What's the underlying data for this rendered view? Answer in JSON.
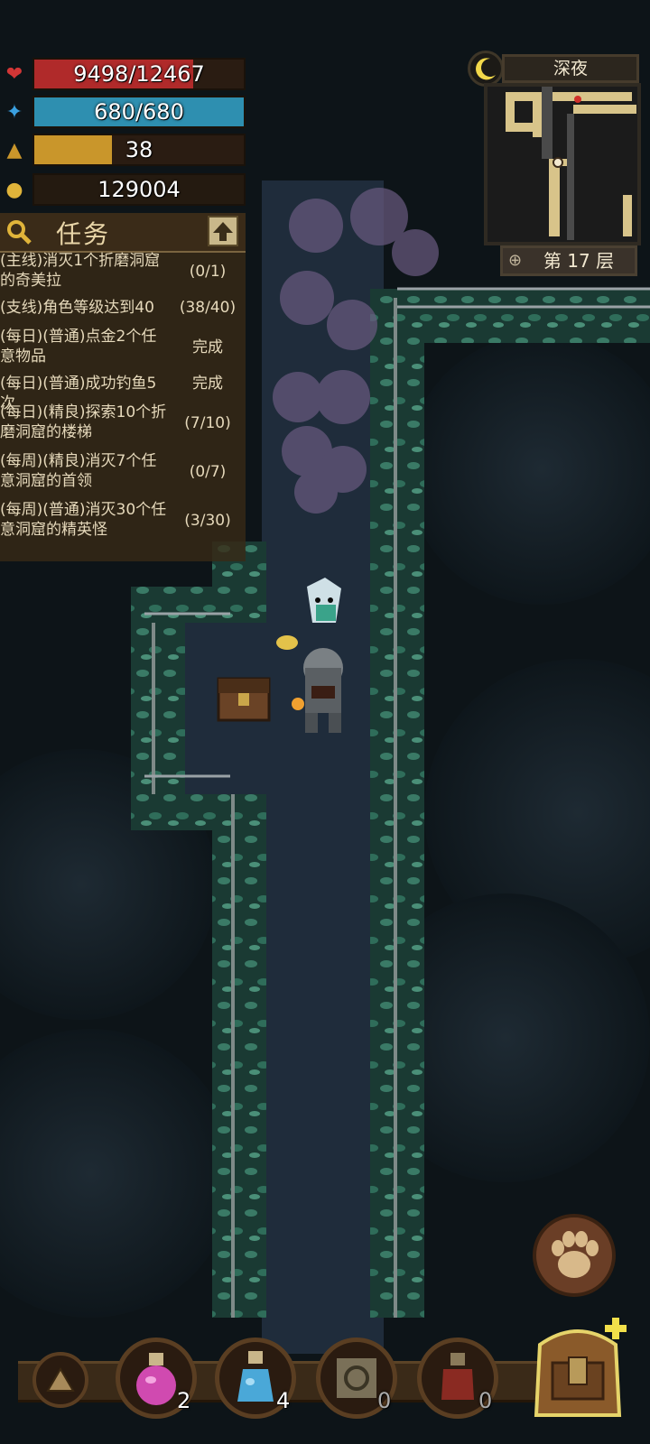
{
  "stats": {
    "hp": {
      "text": "9498/12467",
      "fraction": 0.76,
      "color": "#b02a2a"
    },
    "mp": {
      "text": "680/680",
      "fraction": 1.0,
      "color": "#2e8fb0"
    },
    "level": {
      "text": "38",
      "fraction": 0.37,
      "color": "#c9962b"
    },
    "gold": {
      "text": "129004"
    }
  },
  "quest_panel": {
    "title": "任务",
    "tasks": [
      {
        "name": "(主线)消灭1个折磨洞窟的奇美拉",
        "progress": "(0/1)"
      },
      {
        "name": "(支线)角色等级达到40",
        "progress": "(38/40)"
      },
      {
        "name": "(每日)(普通)点金2个任意物品",
        "progress": "完成"
      },
      {
        "name": "(每日)(普通)成功钓鱼5次",
        "progress": "完成"
      },
      {
        "name": "(每日)(精良)探索10个折磨洞窟的楼梯",
        "progress": "(7/10)"
      },
      {
        "name": "(每周)(精良)消灭7个任意洞窟的首领",
        "progress": "(0/7)"
      },
      {
        "name": "(每周)(普通)消灭30个任意洞窟的精英怪",
        "progress": "(3/30)"
      }
    ]
  },
  "minimap": {
    "time_of_day": "深夜",
    "floor": "第 17 层"
  },
  "hotbar": {
    "items": [
      {
        "icon": "pink-potion-icon",
        "count": "2"
      },
      {
        "icon": "blue-potion-icon",
        "count": "4"
      },
      {
        "icon": "scroll-icon",
        "count": "0"
      },
      {
        "icon": "red-potion-icon",
        "count": "0"
      }
    ]
  },
  "icons": {
    "hp": "heart-icon",
    "mp": "mana-icon",
    "level": "level-triangle-icon",
    "gold": "gold-pile-icon",
    "search": "search-icon",
    "collapse": "arrow-up-icon",
    "pet": "paw-icon",
    "bag": "backpack-icon",
    "menu": "triangle-up-icon"
  }
}
